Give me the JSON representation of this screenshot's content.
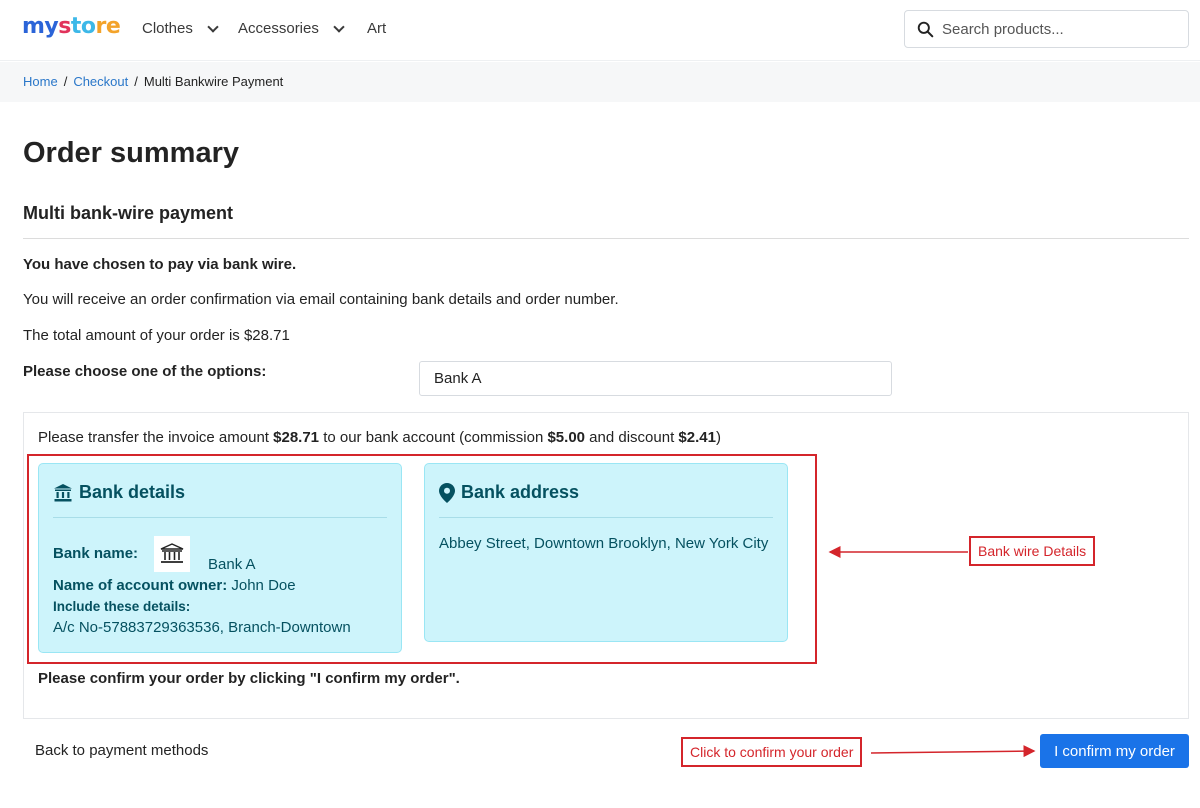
{
  "header": {
    "logo": {
      "part1": "my",
      "part2": "s",
      "part3": "to",
      "part4": "re"
    },
    "nav": [
      {
        "label": "Clothes"
      },
      {
        "label": "Accessories"
      },
      {
        "label": "Art"
      }
    ],
    "search_placeholder": "Search products..."
  },
  "breadcrumb": {
    "items": [
      "Home",
      "Checkout",
      "Multi Bankwire Payment"
    ],
    "separator": "/"
  },
  "main": {
    "title": "Order summary",
    "subtitle": "Multi bank-wire payment",
    "chosen_text": "You have chosen to pay via bank wire.",
    "confirmation_text": "You will receive an order confirmation via email containing bank details and order number.",
    "total_text": "The total amount of your order is $28.71",
    "choose_label": "Please choose one of the options:",
    "selected_option": "Bank A"
  },
  "transfer": {
    "prefix": "Please transfer the invoice amount ",
    "amount": "$28.71",
    "middle": " to our bank account (commission ",
    "commission": "$5.00",
    "and": " and discount ",
    "discount": "$2.41",
    "suffix": ")"
  },
  "bank_details": {
    "title": "Bank details",
    "bank_name_label": "Bank name:",
    "bank_name": "Bank A",
    "owner_label": "Name of account owner:",
    "owner": "John Doe",
    "details_label": "Include these details:",
    "details": "A/c No-57883729363536, Branch-Downtown"
  },
  "bank_address": {
    "title": "Bank address",
    "address": "Abbey Street, Downtown Brooklyn, New York City"
  },
  "confirm_note": "Please confirm your order by clicking \"I confirm my order\".",
  "back_link": "Back to payment methods",
  "confirm_button": "I confirm my order",
  "annotations": {
    "bank_wire": "Bank wire Details",
    "click_confirm": "Click to confirm your order"
  },
  "colors": {
    "accent": "#1a73e8",
    "card_bg": "#cdf4fb",
    "card_text": "#055160",
    "annotation": "#d4252b"
  }
}
